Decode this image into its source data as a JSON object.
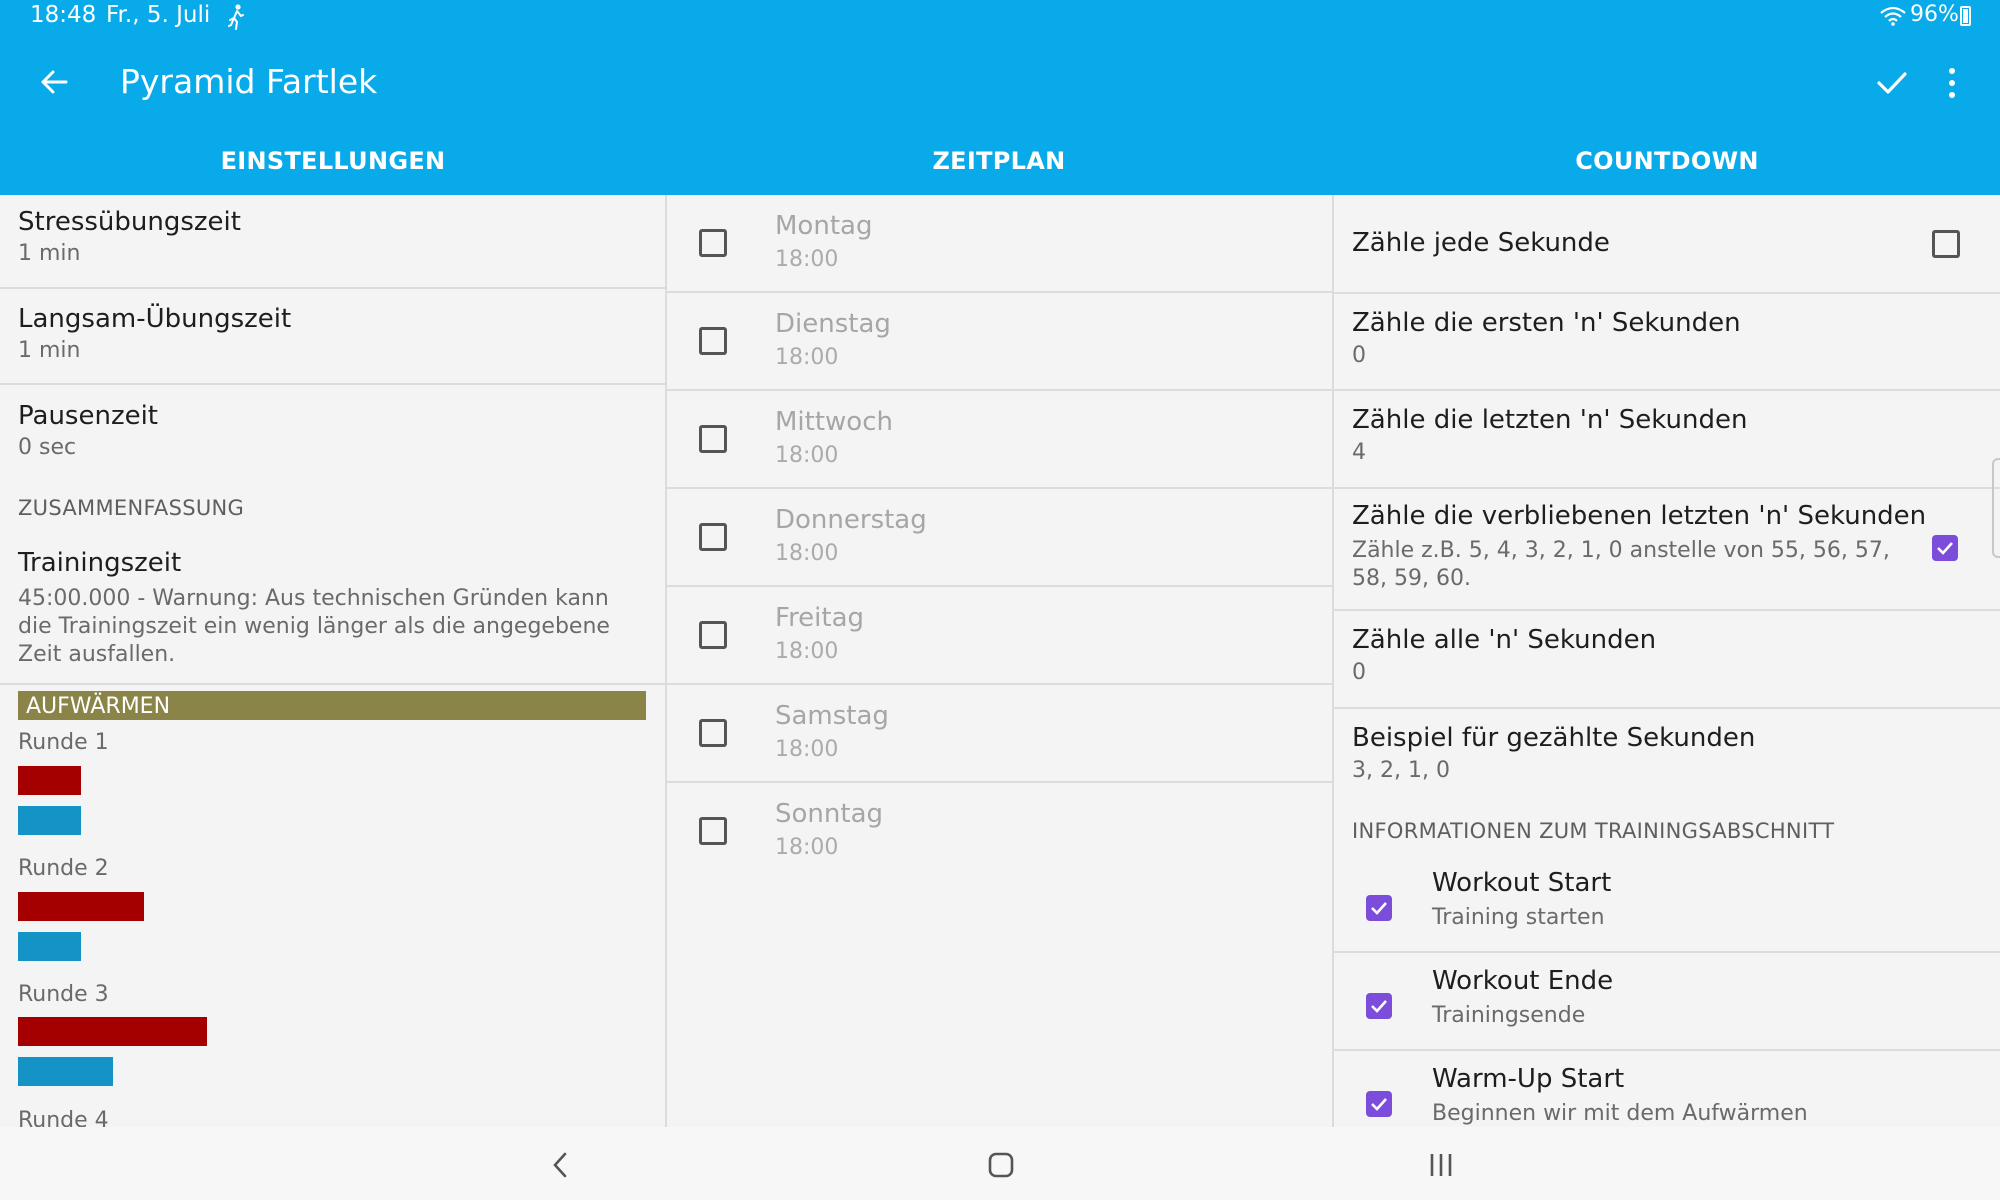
{
  "status": {
    "time": "18:48",
    "date": "Fr., 5. Juli",
    "battery": "96%",
    "icons": [
      "runner-icon",
      "wifi-icon",
      "battery-icon"
    ]
  },
  "appbar": {
    "title": "Pyramid Fartlek",
    "icons": [
      "back-arrow-icon",
      "check-icon",
      "more-vert-icon"
    ],
    "color": "#08aaea"
  },
  "tabs": [
    "EINSTELLUNGEN",
    "ZEITPLAN",
    "COUNTDOWN"
  ],
  "settings": {
    "items": [
      {
        "title": "Stressübungszeit",
        "value": "1 min"
      },
      {
        "title": "Langsam-Übungszeit",
        "value": "1 min"
      },
      {
        "title": "Pausenzeit",
        "value": "0 sec"
      }
    ],
    "summary_header": "ZUSAMMENFASSUNG",
    "training_title": "Trainingszeit",
    "training_text": "45:00.000 - Warnung: Aus technischen Gründen kann die Trainingszeit ein wenig länger als die angegebene Zeit ausfallen.",
    "warmup_label": "AUFWÄRMEN",
    "rounds": [
      {
        "label": "Runde 1",
        "fast": 1,
        "slow": 1
      },
      {
        "label": "Runde 2",
        "fast": 2,
        "slow": 1
      },
      {
        "label": "Runde 3",
        "fast": 3,
        "slow": 1.5
      },
      {
        "label": "Runde 4"
      }
    ],
    "colors": {
      "warmup": "#8a8448",
      "fast": "#a40000",
      "slow": "#1393c6"
    }
  },
  "schedule": {
    "days": [
      {
        "day": "Montag",
        "time": "18:00",
        "checked": false
      },
      {
        "day": "Dienstag",
        "time": "18:00",
        "checked": false
      },
      {
        "day": "Mittwoch",
        "time": "18:00",
        "checked": false
      },
      {
        "day": "Donnerstag",
        "time": "18:00",
        "checked": false
      },
      {
        "day": "Freitag",
        "time": "18:00",
        "checked": false
      },
      {
        "day": "Samstag",
        "time": "18:00",
        "checked": false
      },
      {
        "day": "Sonntag",
        "time": "18:00",
        "checked": false
      }
    ]
  },
  "countdown": {
    "each_second": {
      "title": "Zähle jede Sekunde",
      "checked": false
    },
    "first_n": {
      "title": "Zähle die ersten 'n' Sekunden",
      "value": "0"
    },
    "last_n": {
      "title": "Zähle die letzten 'n' Sekunden",
      "value": "4"
    },
    "remaining_last_n": {
      "title": "Zähle die verbliebenen letzten 'n' Sekunden",
      "desc": "Zähle z.B. 5, 4, 3, 2, 1, 0 anstelle von 55, 56, 57, 58, 59, 60.",
      "checked": true
    },
    "every_n": {
      "title": "Zähle alle 'n' Sekunden",
      "value": "0"
    },
    "example": {
      "title": "Beispiel für gezählte Sekunden",
      "value": "3, 2, 1, 0"
    },
    "info_header": "INFORMATIONEN ZUM TRAININGSABSCHNITT",
    "info_items": [
      {
        "title": "Workout Start",
        "desc": "Training starten",
        "checked": true
      },
      {
        "title": "Workout Ende",
        "desc": "Trainingsende",
        "checked": true
      },
      {
        "title": "Warm-Up Start",
        "desc": "Beginnen wir mit dem Aufwärmen",
        "checked": true
      }
    ],
    "accent": "#7c4ddb"
  },
  "navbar": {
    "icons": [
      "nav-back-icon",
      "nav-home-icon",
      "nav-recents-icon"
    ]
  }
}
